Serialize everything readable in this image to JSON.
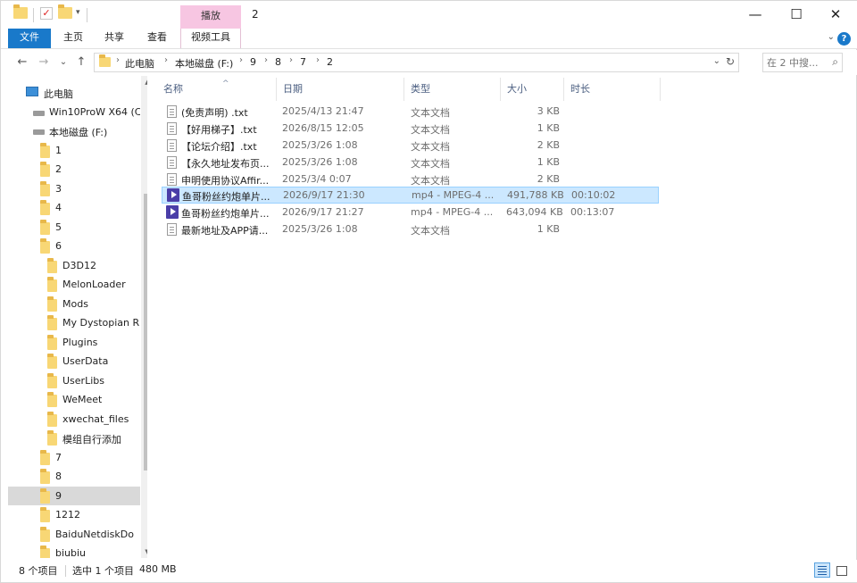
{
  "titlebar": {
    "tools_tab": "播放",
    "title": "2",
    "qa_dropdown": "▾",
    "minimize": "—",
    "maximize": "☐",
    "close": "✕"
  },
  "ribbon": {
    "tabs": [
      {
        "label": "文件"
      },
      {
        "label": "主页"
      },
      {
        "label": "共享"
      },
      {
        "label": "查看"
      },
      {
        "label": "视频工具"
      }
    ],
    "collapse": "⌄",
    "help": "?"
  },
  "address": {
    "back": "←",
    "forward": "→",
    "recent": "⌄",
    "up": "↑",
    "crumbs": [
      "此电脑",
      "本地磁盘 (F:)",
      "9",
      "8",
      "7",
      "2"
    ],
    "crumb_sep": "›",
    "dropdown": "⌄",
    "refresh": "↻",
    "search_placeholder": "在 2 中搜...",
    "search_icon": "⌕"
  },
  "nav": {
    "items": [
      {
        "label": "此电脑",
        "icon": "pc-icon"
      },
      {
        "label": "Win10ProW X64 (C",
        "icon": "drive-icon"
      },
      {
        "label": "本地磁盘 (F:)",
        "icon": "drive-icon"
      },
      {
        "label": "1",
        "icon": "folder-icon"
      },
      {
        "label": "2",
        "icon": "folder-icon"
      },
      {
        "label": "3",
        "icon": "folder-icon"
      },
      {
        "label": "4",
        "icon": "folder-icon"
      },
      {
        "label": "5",
        "icon": "folder-icon"
      },
      {
        "label": "6",
        "icon": "folder-icon"
      },
      {
        "label": "D3D12",
        "icon": "folder-icon"
      },
      {
        "label": "MelonLoader",
        "icon": "folder-icon"
      },
      {
        "label": "Mods",
        "icon": "folder-icon"
      },
      {
        "label": "My Dystopian R",
        "icon": "folder-icon"
      },
      {
        "label": "Plugins",
        "icon": "folder-icon"
      },
      {
        "label": "UserData",
        "icon": "folder-icon"
      },
      {
        "label": "UserLibs",
        "icon": "folder-icon"
      },
      {
        "label": "WeMeet",
        "icon": "folder-icon"
      },
      {
        "label": "xwechat_files",
        "icon": "folder-icon"
      },
      {
        "label": "模组自行添加",
        "icon": "folder-icon"
      },
      {
        "label": "7",
        "icon": "folder-icon"
      },
      {
        "label": "8",
        "icon": "folder-icon"
      },
      {
        "label": "9",
        "icon": "folder-icon"
      },
      {
        "label": "1212",
        "icon": "folder-icon"
      },
      {
        "label": "BaiduNetdiskDo",
        "icon": "folder-icon"
      },
      {
        "label": "biubiu",
        "icon": "folder-icon"
      }
    ],
    "scroll_up": "▲",
    "scroll_down": "▼"
  },
  "columns": {
    "name": "名称",
    "date": "日期",
    "type": "类型",
    "size": "大小",
    "duration": "时长",
    "sort_indicator": "^"
  },
  "files": [
    {
      "name": "(免责声明) .txt",
      "date": "2025/4/13 21:47",
      "type": "文本文档",
      "size": "3 KB",
      "duration": "",
      "icon": "text-file-icon"
    },
    {
      "name": "【好用梯子】.txt",
      "date": "2026/8/15 12:05",
      "type": "文本文档",
      "size": "1 KB",
      "duration": "",
      "icon": "text-file-icon"
    },
    {
      "name": "【论坛介绍】.txt",
      "date": "2025/3/26 1:08",
      "type": "文本文档",
      "size": "2 KB",
      "duration": "",
      "icon": "text-file-icon"
    },
    {
      "name": "【永久地址发布页...",
      "date": "2025/3/26 1:08",
      "type": "文本文档",
      "size": "1 KB",
      "duration": "",
      "icon": "text-file-icon"
    },
    {
      "name": "申明使用协议Affir...",
      "date": "2025/3/4 0:07",
      "type": "文本文档",
      "size": "2 KB",
      "duration": "",
      "icon": "text-file-icon"
    },
    {
      "name": "鱼哥粉丝约炮单片...",
      "date": "2026/9/17 21:30",
      "type": "mp4 - MPEG-4 ...",
      "size": "491,788 KB",
      "duration": "00:10:02",
      "icon": "video-file-icon"
    },
    {
      "name": "鱼哥粉丝约炮单片...",
      "date": "2026/9/17 21:27",
      "type": "mp4 - MPEG-4 ...",
      "size": "643,094 KB",
      "duration": "00:13:07",
      "icon": "video-file-icon"
    },
    {
      "name": "最新地址及APP请...",
      "date": "2025/3/26 1:08",
      "type": "文本文档",
      "size": "1 KB",
      "duration": "",
      "icon": "text-file-icon"
    }
  ],
  "status": {
    "count": "8 个项目",
    "selected": "选中 1 个项目",
    "size": "480 MB"
  }
}
